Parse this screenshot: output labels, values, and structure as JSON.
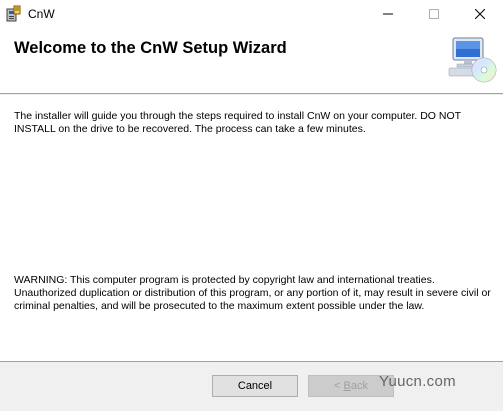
{
  "window": {
    "title": "CnW",
    "icon": "installer-icon",
    "controls": {
      "minimize": "minimize-icon",
      "maximize": "maximize-icon",
      "close": "close-icon"
    }
  },
  "header": {
    "title": "Welcome to the CnW Setup Wizard",
    "graphic": "computer-cd-icon"
  },
  "content": {
    "intro": "The installer will guide you through the steps required to install CnW on your computer.  DO NOT INSTALL on the drive to be recovered.  The process can take a few minutes.",
    "warning": "WARNING: This computer program is protected by copyright law and international treaties. Unauthorized duplication or distribution of this program, or any portion of it, may result in severe civil or criminal penalties, and will be prosecuted to the maximum extent possible under the law."
  },
  "buttons": {
    "cancel": "Cancel",
    "back_prefix": "< ",
    "back_underlined": "B",
    "back_rest": "ack",
    "back_enabled": false
  },
  "watermark": {
    "text": "Yuucn.com"
  }
}
